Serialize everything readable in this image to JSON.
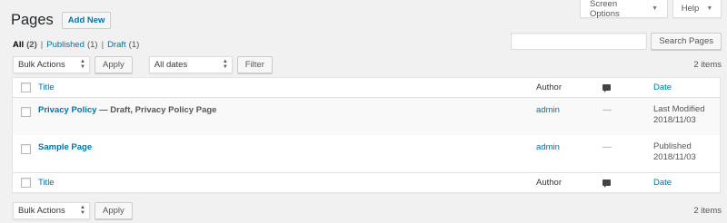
{
  "meta_tabs": {
    "screen_options": "Screen Options",
    "help": "Help"
  },
  "heading": {
    "title": "Pages",
    "add_new": "Add New"
  },
  "filters": {
    "all": {
      "label": "All",
      "count": "(2)"
    },
    "published": {
      "label": "Published",
      "count": "(1)"
    },
    "draft": {
      "label": "Draft",
      "count": "(1)"
    },
    "separator": "|"
  },
  "search": {
    "value": "",
    "button": "Search Pages"
  },
  "tablenav_top": {
    "bulk_actions": "Bulk Actions",
    "apply": "Apply",
    "dates": "All dates",
    "filter": "Filter",
    "count": "2 items"
  },
  "table": {
    "columns": {
      "title": "Title",
      "author": "Author",
      "date": "Date"
    },
    "rows": [
      {
        "title": "Privacy Policy",
        "state": " — Draft, Privacy Policy Page",
        "author": "admin",
        "comments": "—",
        "date_status": "Last Modified",
        "date": "2018/11/03"
      },
      {
        "title": "Sample Page",
        "state": "",
        "author": "admin",
        "comments": "—",
        "date_status": "Published",
        "date": "2018/11/03"
      }
    ]
  },
  "tablenav_bottom": {
    "bulk_actions": "Bulk Actions",
    "apply": "Apply",
    "count": "2 items"
  },
  "icons": {
    "comments": "comment-bubble-icon",
    "dropdown": "chevron-updown-icon",
    "caret": "caret-down-icon"
  },
  "colors": {
    "link": "#0073aa",
    "background": "#f1f1f1",
    "alt_row": "#f9f9f9"
  }
}
